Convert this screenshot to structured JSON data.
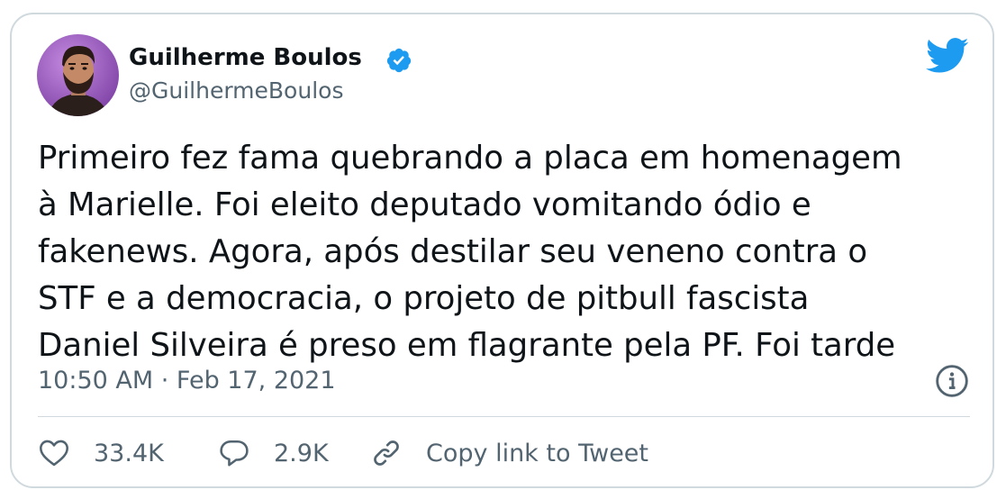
{
  "author": {
    "name": "Guilherme Boulos",
    "handle": "@GuilhermeBoulos",
    "verified": true,
    "avatar_icon": "profile-avatar"
  },
  "tweet": {
    "text_lines": [
      "Primeiro fez fama quebrando a placa em homenagem",
      "à Marielle. Foi eleito deputado vomitando ódio e",
      "fakenews. Agora, após destilar seu veneno contra o",
      "STF e a democracia, o projeto de pitbull fascista",
      "Daniel Silveira é preso em flagrante pela PF. Foi tarde"
    ],
    "timestamp": "10:50 AM · Feb 17, 2021"
  },
  "actions": {
    "likes": "33.4K",
    "replies": "2.9K",
    "copy_link_label": "Copy link to Tweet"
  },
  "icons": {
    "brand": "twitter-bird-icon",
    "verified": "verified-badge-icon",
    "info": "info-icon",
    "like": "heart-icon",
    "reply": "reply-bubble-icon",
    "copy": "link-icon"
  },
  "colors": {
    "brand_blue": "#1d9bf0",
    "text_primary": "#0f1419",
    "text_secondary": "#536471",
    "border": "#cfd9de"
  }
}
